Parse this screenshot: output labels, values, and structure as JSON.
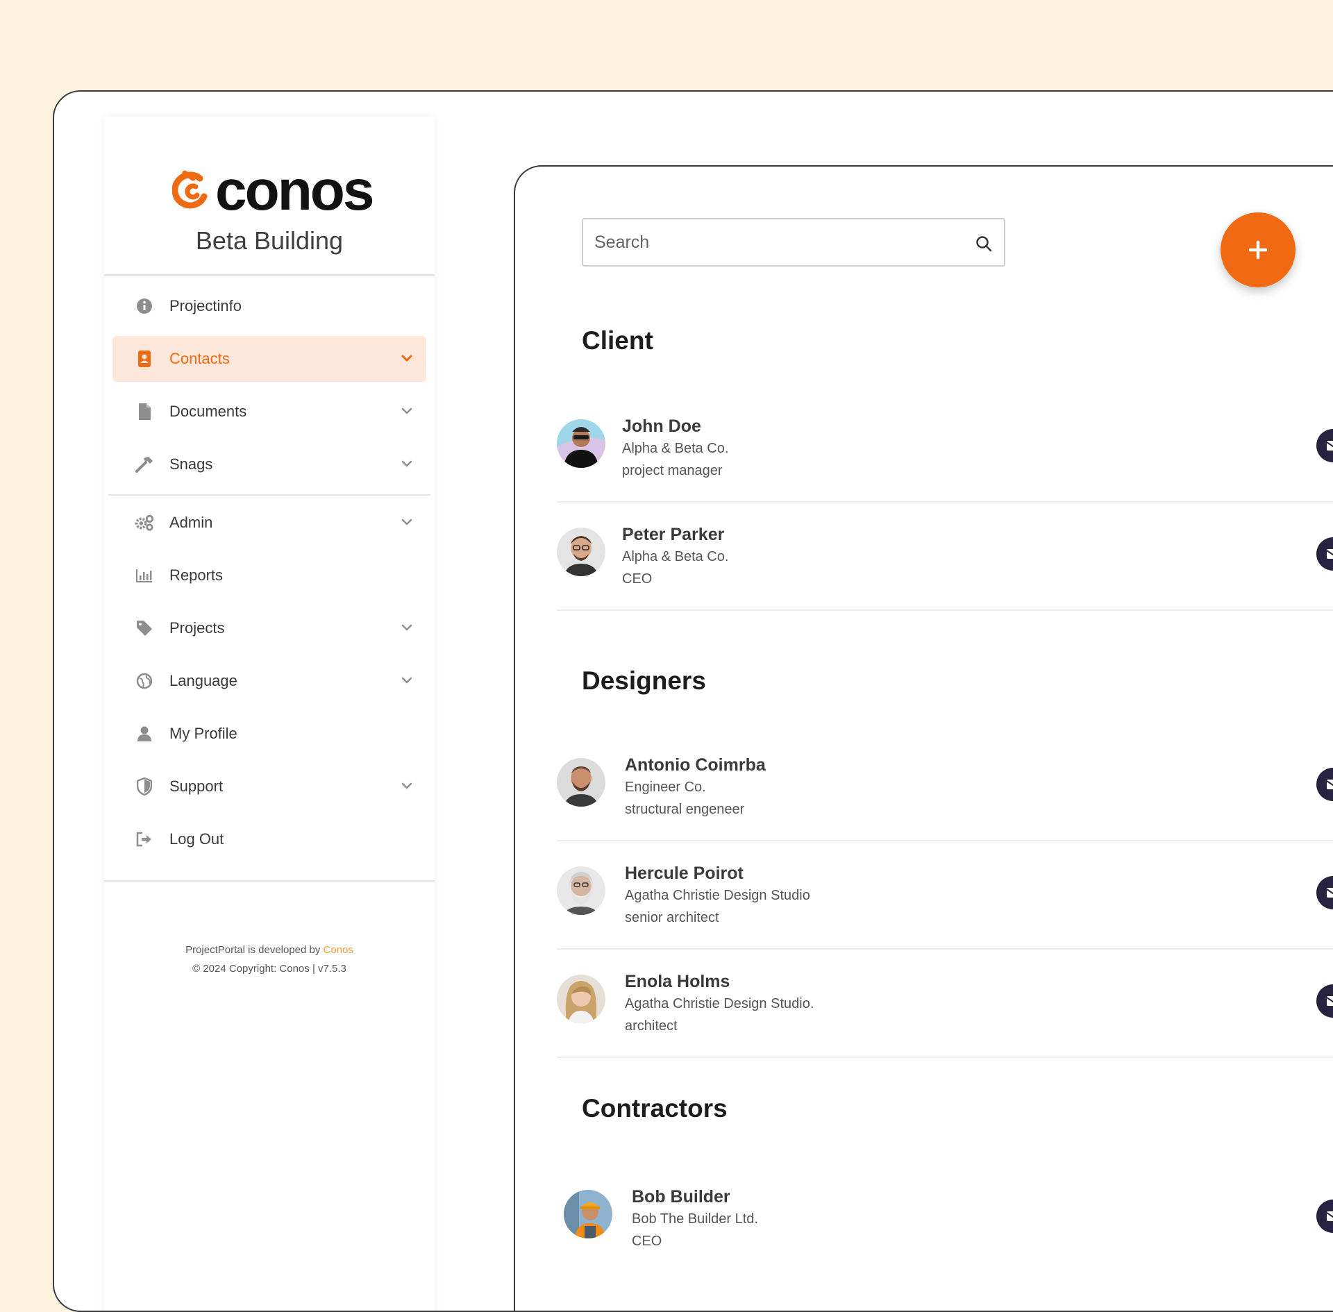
{
  "brand": {
    "logo_text": "conos",
    "project_name": "Beta Building"
  },
  "nav": {
    "items": [
      {
        "label": "Projectinfo",
        "icon": "info-icon"
      },
      {
        "label": "Contacts",
        "icon": "contacts-icon",
        "active": true
      },
      {
        "label": "Documents",
        "icon": "document-icon"
      },
      {
        "label": "Snags",
        "icon": "hammer-icon"
      },
      {
        "label": "Admin",
        "icon": "gears-icon"
      },
      {
        "label": "Reports",
        "icon": "chart-icon"
      },
      {
        "label": "Projects",
        "icon": "tag-icon"
      },
      {
        "label": "Language",
        "icon": "globe-icon"
      },
      {
        "label": "My Profile",
        "icon": "user-icon"
      },
      {
        "label": "Support",
        "icon": "shield-icon"
      },
      {
        "label": "Log Out",
        "icon": "logout-icon"
      }
    ]
  },
  "footer": {
    "line1_prefix": "ProjectPortal is developed by ",
    "line1_link": "Conos",
    "line2": "© 2024 Copyright: Conos | v7.5.3"
  },
  "search": {
    "placeholder": "Search"
  },
  "add_button": {
    "label": "+"
  },
  "sections": [
    {
      "title": "Client",
      "contacts": [
        {
          "name": "John Doe",
          "company": "Alpha & Beta Co.",
          "role": "project manager"
        },
        {
          "name": "Peter Parker",
          "company": "Alpha & Beta Co.",
          "role": "CEO"
        }
      ]
    },
    {
      "title": "Designers",
      "contacts": [
        {
          "name": "Antonio Coimrba",
          "company": "Engineer Co.",
          "role": "structural engeneer"
        },
        {
          "name": "Hercule Poirot",
          "company": "Agatha Christie Design Studio",
          "role": "senior architect"
        },
        {
          "name": "Enola Holms",
          "company": "Agatha Christie Design Studio.",
          "role": "architect"
        }
      ]
    },
    {
      "title": "Contractors",
      "contacts": [
        {
          "name": "Bob Builder",
          "company": "Bob The Builder Ltd.",
          "role": "CEO"
        }
      ]
    }
  ],
  "colors": {
    "accent": "#f06a14",
    "active_bg": "#fde7da",
    "action_button": "#26223f",
    "page_bg": "#fdf2de"
  }
}
